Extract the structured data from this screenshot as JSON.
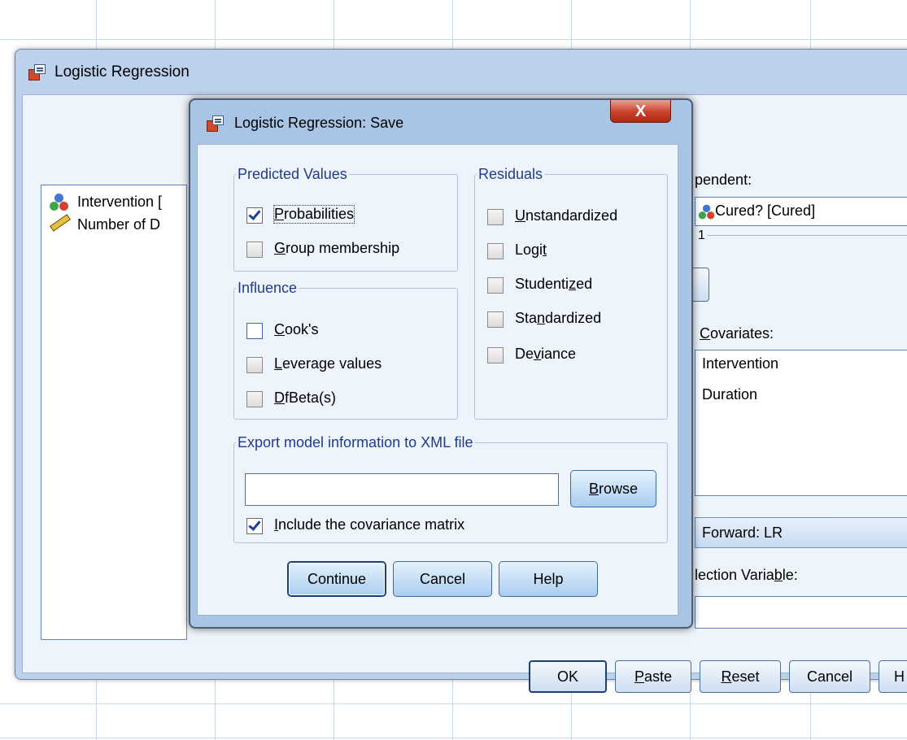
{
  "main_dialog": {
    "title": "Logistic Regression",
    "variables": [
      {
        "label": "Intervention [",
        "icon": "nominal-icon"
      },
      {
        "label": "Number of D",
        "icon": "scale-icon"
      }
    ],
    "dependent_label": "pendent:",
    "dependent_value": "Cured? [Cured]",
    "block_label": "1",
    "covariates_label": "Covariates:",
    "covariates": [
      "Intervention",
      "Duration"
    ],
    "method_value": "Forward: LR",
    "selection_label": "lection Variable:",
    "buttons": {
      "ok": "OK",
      "paste": "Paste",
      "reset": "Reset",
      "cancel": "Cancel",
      "help": "H"
    }
  },
  "save_dialog": {
    "title": "Logistic Regression: Save",
    "close": "X",
    "predicted_values": {
      "legend": "Predicted Values",
      "items": [
        {
          "label": "Probabilities",
          "checked": true
        },
        {
          "label": "Group membership",
          "checked": false
        }
      ]
    },
    "influence": {
      "legend": "Influence",
      "items": [
        {
          "label": "Cook's",
          "checked": false
        },
        {
          "label": "Leverage values",
          "checked": false
        },
        {
          "label": "DfBeta(s)",
          "checked": false
        }
      ]
    },
    "residuals": {
      "legend": "Residuals",
      "items": [
        {
          "label": "Unstandardized",
          "checked": false
        },
        {
          "label": "Logit",
          "checked": false
        },
        {
          "label": "Studentized",
          "checked": false
        },
        {
          "label": "Standardized",
          "checked": false
        },
        {
          "label": "Deviance",
          "checked": false
        }
      ]
    },
    "export": {
      "legend": "Export model information to XML file",
      "file_value": "",
      "browse": "Browse",
      "include_cov": {
        "label": "Include the covariance matrix",
        "checked": true
      }
    },
    "buttons": {
      "continue": "Continue",
      "cancel": "Cancel",
      "help": "Help"
    }
  }
}
